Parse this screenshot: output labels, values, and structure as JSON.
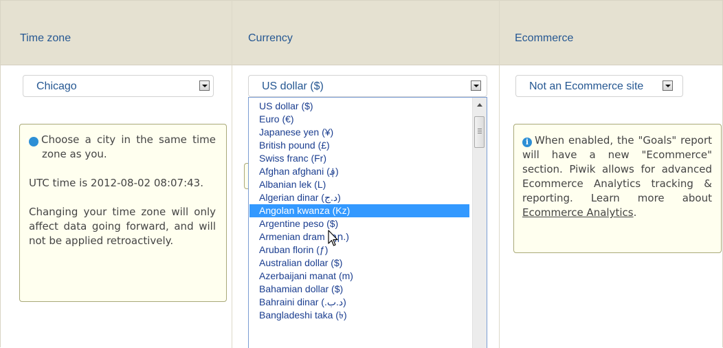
{
  "headers": {
    "timezone": "Time zone",
    "currency": "Currency",
    "ecommerce": "Ecommerce"
  },
  "timezone": {
    "selected": "Chicago",
    "info": {
      "line1": "Choose a city in the same time zone as you.",
      "utc": "UTC time is 2012-08-02 08:07:43.",
      "note": "Changing your time zone will only affect data going forward, and will not be applied retroactively."
    }
  },
  "currency": {
    "selected": "US dollar ($)",
    "highlighted_index": 9,
    "options": [
      "US dollar ($)",
      "Euro (€)",
      "Japanese yen (¥)",
      "British pound (£)",
      "Swiss franc (Fr)",
      "Afghan afghani (؋)",
      "Albanian lek (L)",
      "Algerian dinar (د.ج)",
      "Angolan kwanza (Kz)",
      "Argentine peso ($)",
      "Armenian dram (դր.)",
      "Aruban florin (ƒ)",
      "Australian dollar ($)",
      "Azerbaijani manat (m)",
      "Bahamian dollar ($)",
      "Bahraini dinar (.د.ب)",
      "Bangladeshi taka (৳)"
    ]
  },
  "ecommerce": {
    "selected": "Not an Ecommerce site",
    "info": {
      "text": "When enabled, the \"Goals\" report will have a new \"Ecommerce\" section. Piwik allows for advanced Ecommerce Analytics tracking & reporting. Learn more about",
      "link": "Ecommerce Analytics",
      "after": "."
    }
  },
  "icons": {
    "info": "info-icon",
    "dropdown": "dropdown-arrow-icon",
    "cursor": "mouse-pointer-icon"
  },
  "colors": {
    "header_bg": "#e5e1d1",
    "header_text": "#255792",
    "info_bg": "#ffffef",
    "info_border": "#a8a878",
    "selection": "#3399ff"
  }
}
